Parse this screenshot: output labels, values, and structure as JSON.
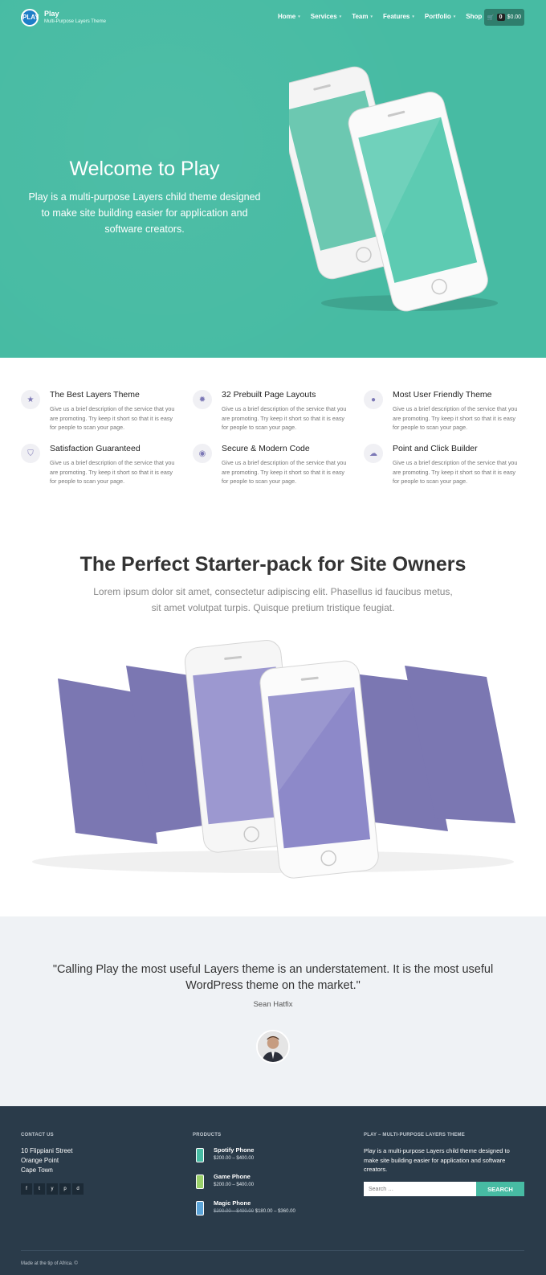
{
  "header": {
    "logo_text": "PLAY",
    "site_title": "Play",
    "tagline": "Multi-Purpose Layers Theme",
    "nav": [
      "Home",
      "Services",
      "Team",
      "Features",
      "Portfolio",
      "Shop"
    ],
    "cart_count": "0",
    "cart_total": "$0.00"
  },
  "hero": {
    "title": "Welcome to Play",
    "description": "Play is a multi-purpose Layers child theme designed to make site building easier for application and software creators.",
    "accent_color": "#47bba3"
  },
  "features": [
    {
      "icon": "star-icon",
      "title": "The Best Layers Theme",
      "desc": "Give us a brief description of the service that you are promoting. Try keep it short so that it is easy for people to scan your page."
    },
    {
      "icon": "gear-icon",
      "title": "32 Prebuilt Page Layouts",
      "desc": "Give us a brief description of the service that you are promoting. Try keep it short so that it is easy for people to scan your page."
    },
    {
      "icon": "user-icon",
      "title": "Most User Friendly Theme",
      "desc": "Give us a brief description of the service that you are promoting. Try keep it short so that it is easy for people to scan your page."
    },
    {
      "icon": "shield-icon",
      "title": "Satisfaction Guaranteed",
      "desc": "Give us a brief description of the service that you are promoting. Try keep it short so that it is easy for people to scan your page."
    },
    {
      "icon": "piggy-bank-icon",
      "title": "Secure & Modern Code",
      "desc": "Give us a brief description of the service that you are promoting. Try keep it short so that it is easy for people to scan your page."
    },
    {
      "icon": "cloud-icon",
      "title": "Point and Click Builder",
      "desc": "Give us a brief description of the service that you are promoting. Try keep it short so that it is easy for people to scan your page."
    }
  ],
  "starter": {
    "title": "The Perfect Starter-pack for Site Owners",
    "description": "Lorem ipsum dolor sit amet, consectetur adipiscing elit. Phasellus id faucibus metus, sit amet volutpat turpis. Quisque pretium tristique feugiat.",
    "accent_color": "#7b77b2"
  },
  "testimonial": {
    "quote": "\"Calling Play the most useful Layers theme is an understatement. It is the most useful WordPress theme on the market.\"",
    "author": "Sean Hatfix"
  },
  "footer": {
    "contact_heading": "CONTACT US",
    "address": [
      "10 Flippiani Street",
      "Orange Point",
      "Cape Town"
    ],
    "socials": [
      "f",
      "t",
      "y",
      "p",
      "d"
    ],
    "products_heading": "PRODUCTS",
    "products": [
      {
        "name": "Spotify Phone",
        "price": "$200.00 – $400.00",
        "old_price": "",
        "color": "#47bba3"
      },
      {
        "name": "Game Phone",
        "price": "$200.00 – $400.00",
        "old_price": "",
        "color": "#9ad06a"
      },
      {
        "name": "Magic Phone",
        "price": "$180.00 – $360.00",
        "old_price": "$200.00 – $400.00",
        "color": "#5ba4d9"
      }
    ],
    "about_heading": "PLAY – MULTI-PURPOSE LAYERS THEME",
    "about_text": "Play is a multi-purpose Layers child theme designed to make site building easier for application and software creators.",
    "search_placeholder": "Search …",
    "search_button": "SEARCH",
    "copyright": "Made at the tip of Africa. ©"
  }
}
